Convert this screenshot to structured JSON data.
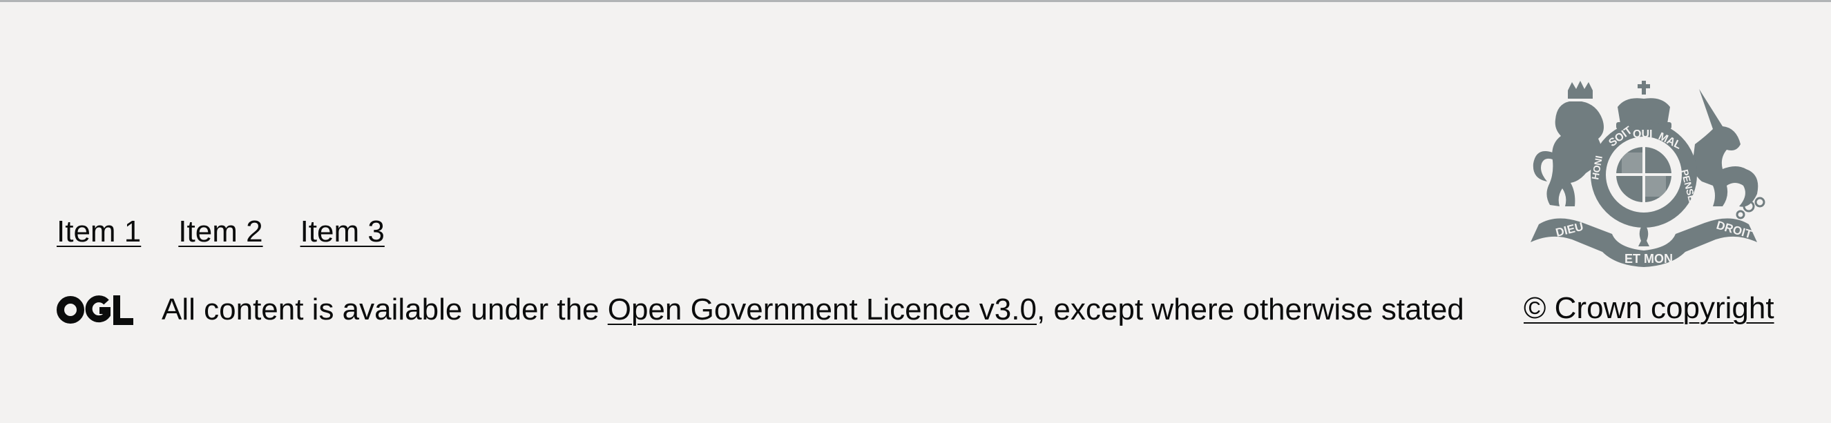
{
  "footer": {
    "nav_items": [
      {
        "label": "Item 1"
      },
      {
        "label": "Item 2"
      },
      {
        "label": "Item 3"
      }
    ],
    "licence": {
      "logo_icon": "ogl-logo-icon",
      "logo_text": "OGL",
      "prefix": "All content is available under the ",
      "link_label": "Open Government Licence v3.0",
      "suffix": ", except where otherwise stated"
    },
    "crest": {
      "icon": "royal-coat-of-arms-icon",
      "motto_top": "HONI SOIT QUI MAL Y PENSE",
      "motto_left": "DIEU",
      "motto_right": "DROIT",
      "motto_bottom": "ET MON"
    },
    "copyright_label": "© Crown copyright"
  },
  "colors": {
    "background": "#f3f2f1",
    "text": "#0b0c0c",
    "border": "#b1b4b6",
    "crest": "#717d80"
  }
}
